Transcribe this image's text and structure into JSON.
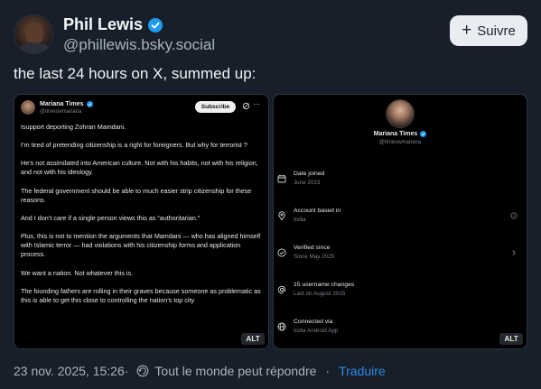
{
  "author": {
    "name": "Phil Lewis",
    "handle": "@phillewis.bsky.social",
    "follow_label": "Suivre"
  },
  "post": {
    "text": "the last 24 hours on X, summed up:",
    "timestamp": "23 nov. 2025, 15:26",
    "reply_setting": "Tout le monde peut répondre",
    "separator": "·",
    "translate_label": "Traduire"
  },
  "left_image": {
    "name": "Mariana Times",
    "handle": "@timeswmariana",
    "subscribe_label": "Subscribe",
    "more_label": "···",
    "alt_label": "ALT",
    "paragraphs": [
      "Isupport deporting Zohran Mamdani.",
      "I’m tired of pretending citizenship is a right for foreigners. But why for terrorist ?",
      "He’s not assimilated into American culture. Not with his habits, not with his religion, and not with his ideology.",
      "The federal government should be able to much easier strip citizenship for these reasons.",
      "And I don’t care if a single person views this as “authoritarian.”",
      "Plus, this is not to mention the arguments that Mamdani — who has aligned himself with Islamic terror — had violations with his citizenship forms and application process.",
      "We want a nation. Not whatever this is.",
      "The founding fathers are rolling in their graves because someone as problematic as this is able to get this close to controlling the nation’s top city"
    ]
  },
  "right_image": {
    "name": "Mariana Times",
    "handle": "@timeswmariana",
    "alt_label": "ALT",
    "rows": [
      {
        "icon": "calendar-icon",
        "title": "Date joined",
        "sub": "June 2023"
      },
      {
        "icon": "location-icon",
        "title": "Account based in",
        "sub": "India"
      },
      {
        "icon": "verified-check-icon",
        "title": "Verified since",
        "sub": "Since May 2025"
      },
      {
        "icon": "at-sign-icon",
        "title": "15 username changes",
        "sub": "Last on August 2025"
      },
      {
        "icon": "globe-icon",
        "title": "Connected via",
        "sub": "India Android App"
      }
    ]
  },
  "colors": {
    "background": "#171f2a",
    "accent": "#2e8ae6",
    "verified": "#1d9bf0"
  }
}
